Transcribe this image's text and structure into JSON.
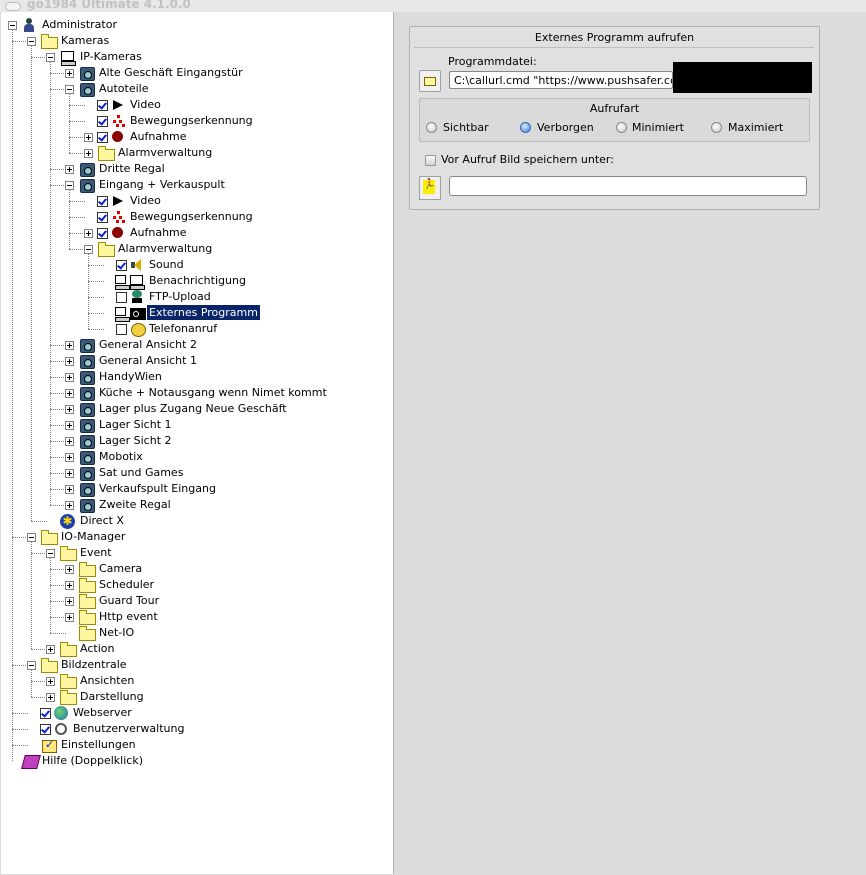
{
  "window": {
    "title": "go1984 Ultimate 4.1.0.0"
  },
  "tree": [
    {
      "label": "Administrator",
      "level": 0,
      "icon": "user-icon",
      "exp": "minus",
      "cb": null,
      "sel": false
    },
    {
      "label": "Kameras",
      "level": 1,
      "icon": "folder-open-icon",
      "exp": "minus",
      "cb": null,
      "sel": false
    },
    {
      "label": "IP-Kameras",
      "level": 2,
      "icon": "network-camera-icon",
      "exp": "minus",
      "cb": null,
      "sel": false
    },
    {
      "label": "Alte Geschäft Eingangstür",
      "level": 3,
      "icon": "camera-icon",
      "exp": "plus",
      "cb": null,
      "sel": false
    },
    {
      "label": "Autoteile",
      "level": 3,
      "icon": "camera-icon",
      "exp": "minus",
      "cb": null,
      "sel": false
    },
    {
      "label": "Video",
      "level": 4,
      "icon": "play-icon",
      "exp": null,
      "cb": "on",
      "sel": false
    },
    {
      "label": "Bewegungserkennung",
      "level": 4,
      "icon": "motion-icon",
      "exp": null,
      "cb": "on",
      "sel": false
    },
    {
      "label": "Aufnahme",
      "level": 4,
      "icon": "record-icon",
      "exp": "plus",
      "cb": "on",
      "sel": false
    },
    {
      "label": "Alarmverwaltung",
      "level": 4,
      "icon": "folder-icon",
      "exp": "plus",
      "cb": null,
      "sel": false
    },
    {
      "label": "Dritte Regal",
      "level": 3,
      "icon": "camera-icon",
      "exp": "plus",
      "cb": null,
      "sel": false
    },
    {
      "label": "Eingang + Verkauspult",
      "level": 3,
      "icon": "camera-icon",
      "exp": "minus",
      "cb": null,
      "sel": false
    },
    {
      "label": "Video",
      "level": 4,
      "icon": "play-icon",
      "exp": null,
      "cb": "on",
      "sel": false
    },
    {
      "label": "Bewegungserkennung",
      "level": 4,
      "icon": "motion-icon",
      "exp": null,
      "cb": "on",
      "sel": false
    },
    {
      "label": "Aufnahme",
      "level": 4,
      "icon": "record-icon",
      "exp": "plus",
      "cb": "on",
      "sel": false
    },
    {
      "label": "Alarmverwaltung",
      "level": 4,
      "icon": "folder-open-icon",
      "exp": "minus",
      "cb": null,
      "sel": false
    },
    {
      "label": "Sound",
      "level": 5,
      "icon": "speaker-icon",
      "exp": null,
      "cb": "on",
      "sel": false
    },
    {
      "label": "Benachrichtigung",
      "level": 5,
      "icon": "notification-icon",
      "exp": null,
      "cb": "mon",
      "sel": false
    },
    {
      "label": "FTP-Upload",
      "level": 5,
      "icon": "ftp-icon",
      "exp": null,
      "cb": "off",
      "sel": false
    },
    {
      "label": "Externes Programm",
      "level": 5,
      "icon": "program-icon",
      "exp": null,
      "cb": "mon",
      "sel": true
    },
    {
      "label": "Telefonanruf",
      "level": 5,
      "icon": "phone-icon",
      "exp": null,
      "cb": "off",
      "sel": false
    },
    {
      "label": "General  Ansicht 2",
      "level": 3,
      "icon": "camera-icon",
      "exp": "plus",
      "cb": null,
      "sel": false
    },
    {
      "label": "General Ansicht 1",
      "level": 3,
      "icon": "camera-icon",
      "exp": "plus",
      "cb": null,
      "sel": false
    },
    {
      "label": "HandyWien",
      "level": 3,
      "icon": "camera-icon",
      "exp": "plus",
      "cb": null,
      "sel": false
    },
    {
      "label": "Küche + Notausgang wenn Nimet kommt",
      "level": 3,
      "icon": "camera-icon",
      "exp": "plus",
      "cb": null,
      "sel": false
    },
    {
      "label": "Lager plus Zugang Neue Geschäft",
      "level": 3,
      "icon": "camera-icon",
      "exp": "plus",
      "cb": null,
      "sel": false
    },
    {
      "label": "Lager Sicht 1",
      "level": 3,
      "icon": "camera-icon",
      "exp": "plus",
      "cb": null,
      "sel": false
    },
    {
      "label": "Lager Sicht 2",
      "level": 3,
      "icon": "camera-icon",
      "exp": "plus",
      "cb": null,
      "sel": false
    },
    {
      "label": "Mobotix",
      "level": 3,
      "icon": "camera-icon",
      "exp": "plus",
      "cb": null,
      "sel": false
    },
    {
      "label": "Sat und Games",
      "level": 3,
      "icon": "camera-icon",
      "exp": "plus",
      "cb": null,
      "sel": false
    },
    {
      "label": "Verkaufspult Eingang",
      "level": 3,
      "icon": "camera-icon",
      "exp": "plus",
      "cb": null,
      "sel": false
    },
    {
      "label": "Zweite Regal",
      "level": 3,
      "icon": "camera-icon",
      "exp": "plus",
      "cb": null,
      "sel": false
    },
    {
      "label": "Direct X",
      "level": 2,
      "icon": "directx-icon",
      "exp": null,
      "cb": null,
      "sel": false
    },
    {
      "label": "IO-Manager",
      "level": 1,
      "icon": "folder-open-icon",
      "exp": "minus",
      "cb": null,
      "sel": false
    },
    {
      "label": "Event",
      "level": 2,
      "icon": "folder-open-icon",
      "exp": "minus",
      "cb": null,
      "sel": false
    },
    {
      "label": "Camera",
      "level": 3,
      "icon": "folder-icon",
      "exp": "plus",
      "cb": null,
      "sel": false
    },
    {
      "label": "Scheduler",
      "level": 3,
      "icon": "folder-icon",
      "exp": "plus",
      "cb": null,
      "sel": false
    },
    {
      "label": "Guard Tour",
      "level": 3,
      "icon": "folder-icon",
      "exp": "plus",
      "cb": null,
      "sel": false
    },
    {
      "label": "Http event",
      "level": 3,
      "icon": "folder-icon",
      "exp": "plus",
      "cb": null,
      "sel": false
    },
    {
      "label": "Net-IO",
      "level": 3,
      "icon": "folder-icon",
      "exp": null,
      "cb": null,
      "sel": false
    },
    {
      "label": "Action",
      "level": 2,
      "icon": "folder-icon",
      "exp": "plus",
      "cb": null,
      "sel": false
    },
    {
      "label": "Bildzentrale",
      "level": 1,
      "icon": "folder-open-icon",
      "exp": "minus",
      "cb": null,
      "sel": false
    },
    {
      "label": "Ansichten",
      "level": 2,
      "icon": "folder-icon",
      "exp": "plus",
      "cb": null,
      "sel": false
    },
    {
      "label": "Darstellung",
      "level": 2,
      "icon": "folder-icon",
      "exp": "plus",
      "cb": null,
      "sel": false
    },
    {
      "label": "Webserver",
      "level": 1,
      "icon": "globe-icon",
      "exp": null,
      "cb": "on",
      "sel": false
    },
    {
      "label": "Benutzerverwaltung",
      "level": 1,
      "icon": "users-icon",
      "exp": null,
      "cb": "on",
      "sel": false
    },
    {
      "label": "Einstellungen",
      "level": 1,
      "icon": "settings-icon",
      "exp": null,
      "cb": null,
      "sel": false
    },
    {
      "label": "Hilfe (Doppelklick)",
      "level": 0,
      "icon": "help-book-icon",
      "exp": null,
      "cb": null,
      "sel": false
    }
  ],
  "panel": {
    "title": "Externes Programm aufrufen",
    "program_label": "Programmdatei:",
    "program_value": "C:\\callurl.cmd \"https://www.pushsafer.com/ap",
    "call_type_title": "Aufrufart",
    "options": [
      {
        "label": "Sichtbar",
        "selected": false
      },
      {
        "label": "Verborgen",
        "selected": true
      },
      {
        "label": "Minimiert",
        "selected": false
      },
      {
        "label": "Maximiert",
        "selected": false
      }
    ],
    "save_image_label": "Vor Aufruf Bild speichern unter:",
    "save_image_value": ""
  }
}
